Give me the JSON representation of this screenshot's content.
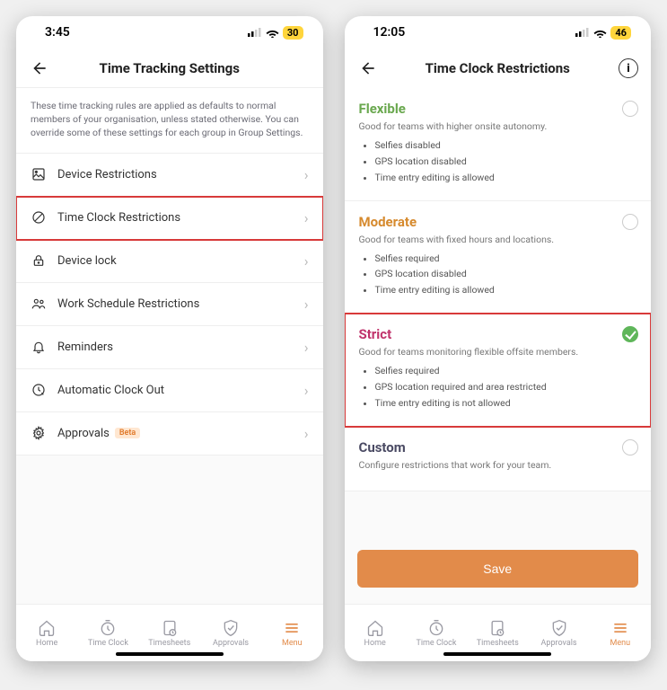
{
  "phone1": {
    "status": {
      "time": "3:45",
      "battery": "30"
    },
    "header": {
      "title": "Time Tracking Settings"
    },
    "intro": "These time tracking rules are applied as defaults to normal members of your organisation, unless stated otherwise. You can override some of these settings for each group in Group Settings.",
    "rows": {
      "device_restrictions": "Device Restrictions",
      "time_clock_restrictions": "Time Clock Restrictions",
      "device_lock": "Device lock",
      "work_schedule": "Work Schedule Restrictions",
      "reminders": "Reminders",
      "auto_clock_out": "Automatic Clock Out",
      "approvals": "Approvals",
      "approvals_badge": "Beta"
    }
  },
  "phone2": {
    "status": {
      "time": "12:05",
      "battery": "46"
    },
    "header": {
      "title": "Time Clock Restrictions"
    },
    "options": {
      "flexible": {
        "title": "Flexible",
        "sub": "Good for teams with higher onsite autonomy.",
        "b1": "Selfies disabled",
        "b2": "GPS location disabled",
        "b3": "Time entry editing is allowed"
      },
      "moderate": {
        "title": "Moderate",
        "sub": "Good for teams with fixed hours and locations.",
        "b1": "Selfies required",
        "b2": "GPS location disabled",
        "b3": "Time entry editing is allowed"
      },
      "strict": {
        "title": "Strict",
        "sub": "Good for teams monitoring flexible offsite members.",
        "b1": "Selfies required",
        "b2": "GPS location required and area restricted",
        "b3": "Time entry editing is not allowed"
      },
      "custom": {
        "title": "Custom",
        "sub": "Configure restrictions that work for your team."
      }
    },
    "save_label": "Save"
  },
  "bottom_nav": {
    "home": "Home",
    "time_clock": "Time Clock",
    "timesheets": "Timesheets",
    "approvals": "Approvals",
    "menu": "Menu"
  }
}
